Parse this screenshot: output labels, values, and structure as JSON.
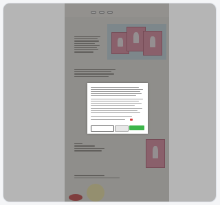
{
  "page": {
    "brand": "",
    "tabs": [
      "",
      "",
      ""
    ],
    "hero_title": ""
  }
}
